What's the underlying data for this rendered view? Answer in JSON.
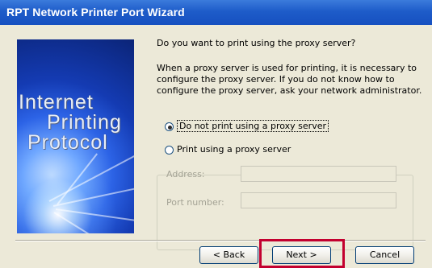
{
  "window": {
    "title": "RPT Network Printer Port Wizard"
  },
  "banner": {
    "words": [
      "Internet",
      "Printing",
      "Protocol"
    ]
  },
  "question": "Do you want to print using the proxy server?",
  "description": "When a proxy server is used for printing, it is necessary to configure the proxy server. If you do not know how to configure the proxy server, ask your network administrator.",
  "options": {
    "no_proxy": {
      "label": "Do not print using a proxy server",
      "selected": true
    },
    "use_proxy": {
      "label": "Print using a proxy server",
      "selected": false
    }
  },
  "proxy": {
    "address_label": "Address:",
    "address_value": "",
    "port_label": "Port number:",
    "port_value": ""
  },
  "buttons": {
    "back": "< Back",
    "next": "Next >",
    "cancel": "Cancel"
  },
  "colors": {
    "highlight": "#c3002f",
    "title_bar": "#1e5cc9"
  }
}
